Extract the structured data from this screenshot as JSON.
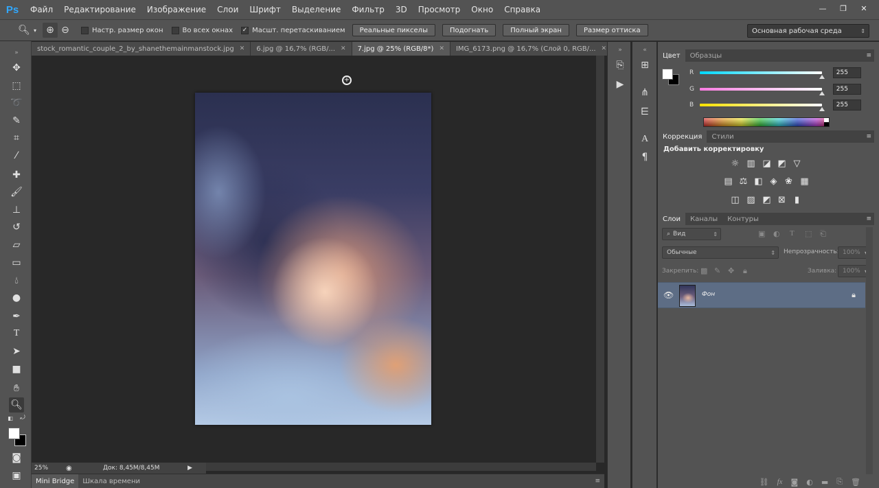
{
  "app": {
    "logo": "Ps",
    "menu": [
      "Файл",
      "Редактирование",
      "Изображение",
      "Слои",
      "Шрифт",
      "Выделение",
      "Фильтр",
      "3D",
      "Просмотр",
      "Окно",
      "Справка"
    ],
    "window_controls": [
      "minimize",
      "restore",
      "close"
    ]
  },
  "options": {
    "check_resize_windows": "Настр. размер окон",
    "check_all_windows": "Во всех окнах",
    "check_scrubby_zoom": "Масшт. перетаскиванием",
    "btn_actual_pixels": "Реальные пикселы",
    "btn_fit_screen": "Подогнать",
    "btn_fill_screen": "Полный экран",
    "btn_print_size": "Размер оттиска",
    "workspace": "Основная рабочая среда"
  },
  "tabs": [
    {
      "label": "stock_romantic_couple_2_by_shanethemainmanstock.jpg",
      "active": false
    },
    {
      "label": "6.jpg @ 16,7% (RGB/...",
      "active": false
    },
    {
      "label": "7.jpg @ 25% (RGB/8*)",
      "active": true
    },
    {
      "label": "IMG_6173.png @ 16,7% (Слой 0, RGB/...",
      "active": false
    }
  ],
  "status": {
    "zoom": "25%",
    "doc_size": "Док: 8,45M/8,45M"
  },
  "bottom_tabs": [
    "Mini Bridge",
    "Шкала времени"
  ],
  "color_panel": {
    "tabs": [
      "Цвет",
      "Образцы"
    ],
    "channels": [
      {
        "label": "R",
        "value": "255",
        "color": "#00d8ff"
      },
      {
        "label": "G",
        "value": "255",
        "color": "#ff7ce2"
      },
      {
        "label": "B",
        "value": "255",
        "color": "#ffe100"
      }
    ],
    "foreground": "#ffffff",
    "background": "#000000"
  },
  "adjustments_panel": {
    "tabs": [
      "Коррекция",
      "Стили"
    ],
    "heading": "Добавить корректировку"
  },
  "layers_panel": {
    "tabs": [
      "Слои",
      "Каналы",
      "Контуры"
    ],
    "filter_kind": "Вид",
    "blend_mode": "Обычные",
    "opacity_label": "Непрозрачность:",
    "opacity_value": "100%",
    "lock_label": "Закрепить:",
    "fill_label": "Заливка:",
    "fill_value": "100%",
    "layers": [
      {
        "name": "Фон",
        "visible": true,
        "locked": true
      }
    ]
  }
}
